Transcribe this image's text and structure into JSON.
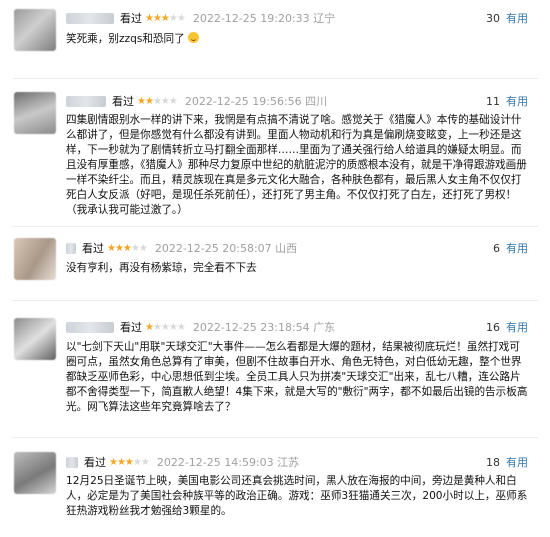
{
  "comments": [
    {
      "watched": "看过",
      "rating": 3,
      "time": "2022-12-25 19:20:33",
      "location": "辽宁",
      "votes": "30",
      "useful": "有用",
      "text": "笑死乘，别zzqs和恐同了",
      "emoji": "grinning-emoji"
    },
    {
      "watched": "看过",
      "rating": 2,
      "time": "2022-12-25 19:56:56",
      "location": "四川",
      "votes": "11",
      "useful": "有用",
      "text": "四集剧情跟别水一样的讲下来，我惘是有点搞不清说了啥。感觉关于《猎魔人》本传的基础设计什么都讲了，但是你感觉有什么都没有讲到。里面人物动机和行为真是偏刷烧变眩变，上一秒还是这样，下一秒就为了剧情转折立马打翻全面那样……里面为了通关强行给人给道具的嫌疑太明显。而且没有厚重感，《猎魔人》那种尽力复原中世纪的航脏泥泞的质感根本没有，就是干净得跟游戏画册一样不染纤尘。而且，精灵族现在真是多元文化大融合，各种肤色都有，最后黑人女主角不仅仅打死白人女反派（好吧，是现任杀死前任），还打死了男主角。不仅仅打死了白左，还打死了男权！（我承认我可能过激了。）"
    },
    {
      "watched": "看过",
      "rating": 3,
      "time": "2022-12-25 20:58:07",
      "location": "山西",
      "votes": "6",
      "useful": "有用",
      "text": "没有亨利，再没有杨紫琼，完全看不下去"
    },
    {
      "watched": "看过",
      "rating": 1,
      "time": "2022-12-25 23:18:54",
      "location": "广东",
      "votes": "16",
      "useful": "有用",
      "text": "以\"七剑下天山\"用联\"天球交汇\"大事件——怎么看都是大爆的题材，结果被彻底玩烂！虽然打戏可圈可点，虽然女角色总算有了审美，但剧不住故事白开水、角色无特色，对白低幼无趣，整个世界都缺乏巫师色彩，中心思想低到尘埃。全员工具人只为拼凑\"天球交汇\"出来，乱七八糟，连公路片都不舍得类型一下，简直歉人绝望！4集下来，就是大写的\"敷衍\"两字，都不如最后出镜的告示板高光。网飞算法这些年究竟算啥去了？"
    },
    {
      "watched": "看过",
      "rating": 3,
      "time": "2022-12-25 14:59:03",
      "location": "江苏",
      "votes": "18",
      "useful": "有用",
      "text": "12月25日圣诞节上映，美国电影公司还真会挑选时间，黑人放在海报的中间，旁边是黄种人和白人，必定是为了美国社会种族平等的政治正确。游戏：巫师3狂猫通关三次，200小时以上，巫师系狂热游戏粉丝我才勉强给3颗星的。"
    }
  ]
}
